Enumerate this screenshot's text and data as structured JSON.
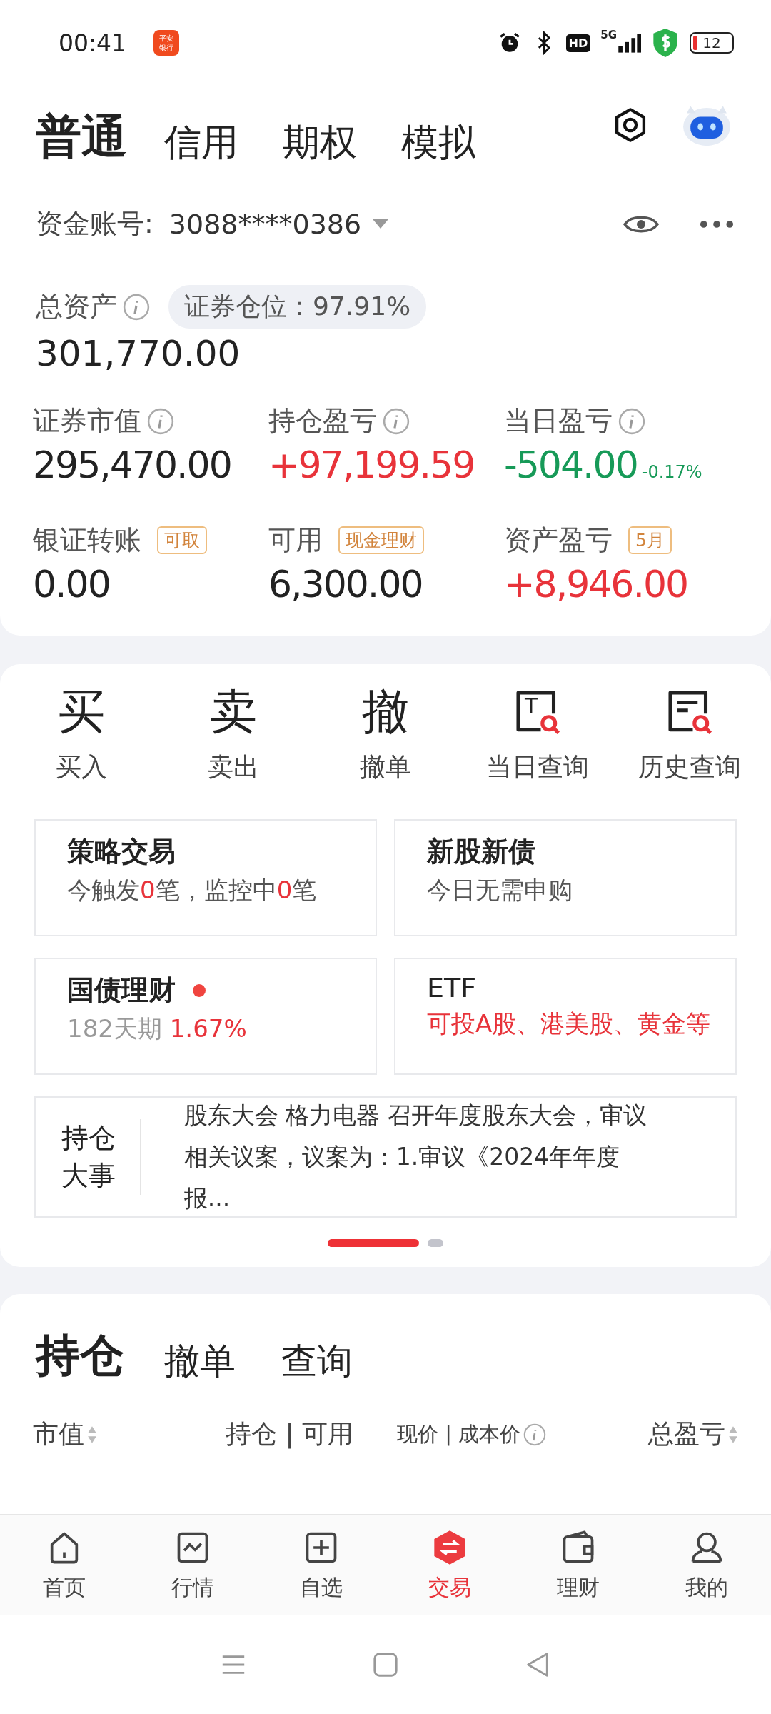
{
  "status_bar": {
    "time": "00:41",
    "app_badge": "平安银行",
    "network": "5G",
    "hd": "HD",
    "battery": "12"
  },
  "account_tabs": [
    {
      "label": "普通",
      "selected": true
    },
    {
      "label": "信用",
      "selected": false
    },
    {
      "label": "期权",
      "selected": false
    },
    {
      "label": "模拟",
      "selected": false
    }
  ],
  "account": {
    "label": "资金账号:",
    "number": "3088****0386"
  },
  "total_assets": {
    "label": "总资产",
    "position_pill": "证券仓位：97.91%",
    "value": "301,770.00"
  },
  "metrics": [
    {
      "label": "证券市值",
      "info": true,
      "value": "295,470.00",
      "color": "#222222"
    },
    {
      "label": "持仓盈亏",
      "info": true,
      "value": "+97,199.59",
      "color": "#e8333a"
    },
    {
      "label": "当日盈亏",
      "info": true,
      "value": "-504.00",
      "color": "#179a58",
      "sub": "-0.17%"
    },
    {
      "label": "银证转账",
      "info": false,
      "tag": "可取",
      "value": "0.00",
      "color": "#222222"
    },
    {
      "label": "可用",
      "info": false,
      "tag": "现金理财",
      "value": "6,300.00",
      "color": "#222222"
    },
    {
      "label": "资产盈亏",
      "info": false,
      "tag": "5月",
      "value": "+8,946.00",
      "color": "#e8333a"
    }
  ],
  "actions": [
    {
      "label": "买入",
      "icon": {
        "kind": "glyph",
        "glyph": "买"
      }
    },
    {
      "label": "卖出",
      "icon": {
        "kind": "glyph",
        "glyph": "卖"
      }
    },
    {
      "label": "撤单",
      "icon": {
        "kind": "glyph",
        "glyph": "撤"
      }
    },
    {
      "label": "当日查询",
      "icon": {
        "kind": "letter-search",
        "letter": "T"
      }
    },
    {
      "label": "历史查询",
      "icon": {
        "kind": "list-search"
      }
    }
  ],
  "feature_cards": [
    {
      "title": "策略交易",
      "dot": false,
      "segments": [
        {
          "text": "今触发",
          "highlight": false
        },
        {
          "text": "0",
          "highlight": true
        },
        {
          "text": "笔，监控中",
          "highlight": false
        },
        {
          "text": "0",
          "highlight": true
        },
        {
          "text": "笔",
          "highlight": false
        }
      ]
    },
    {
      "title": "新股新债",
      "dot": false,
      "segments": [
        {
          "text": "今日无需申购",
          "highlight": false
        }
      ]
    },
    {
      "title": "国债理财",
      "dot": true,
      "segments": [
        {
          "text": "182天期 ",
          "highlight": false
        },
        {
          "text": "1.67%",
          "highlight": true
        }
      ]
    },
    {
      "title": "ETF",
      "dot": false,
      "segments": [
        {
          "text": "可投A股、港美股、黄金等",
          "highlight": true
        }
      ]
    }
  ],
  "news": {
    "label": "持仓大事",
    "text": "股东大会 格力电器 召开年度股东大会，审议相关议案，议案为：1.审议《2024年年度报..."
  },
  "pager": [
    {
      "selected": true
    },
    {
      "selected": false
    }
  ],
  "holdings_tabs": [
    {
      "label": "持仓",
      "selected": true
    },
    {
      "label": "撤单",
      "selected": false
    },
    {
      "label": "查询",
      "selected": false
    }
  ],
  "columns": [
    {
      "label": "市值",
      "kind": "sort"
    },
    {
      "label": "持仓 | 可用",
      "kind": "plain"
    },
    {
      "label": "现价 | 成本价",
      "kind": "info"
    },
    {
      "label": "总盈亏",
      "kind": "sort"
    }
  ],
  "bottom_nav": [
    {
      "label": "首页",
      "selected": false
    },
    {
      "label": "行情",
      "selected": false
    },
    {
      "label": "自选",
      "selected": false
    },
    {
      "label": "交易",
      "selected": true
    },
    {
      "label": "理财",
      "selected": false
    },
    {
      "label": "我的",
      "selected": false
    }
  ]
}
